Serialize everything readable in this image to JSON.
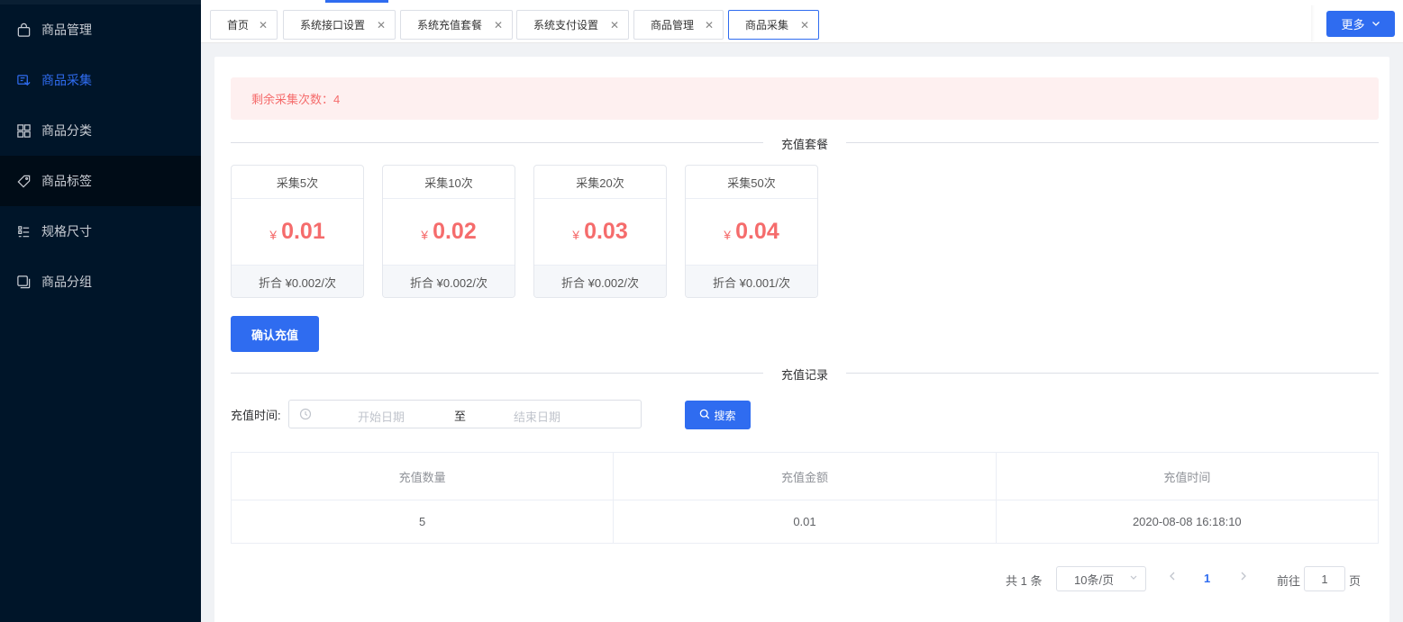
{
  "sidebar": {
    "items": [
      {
        "label": "商品管理",
        "icon": "shopping-bag-icon",
        "active": false
      },
      {
        "label": "商品采集",
        "icon": "collect-icon",
        "active": true
      },
      {
        "label": "商品分类",
        "icon": "grid-icon",
        "active": false
      },
      {
        "label": "商品标签",
        "icon": "tag-icon",
        "active": false
      },
      {
        "label": "规格尺寸",
        "icon": "list-icon",
        "active": false
      },
      {
        "label": "商品分组",
        "icon": "copy-icon",
        "active": false
      }
    ]
  },
  "tabs": [
    {
      "label": "首页",
      "active": false
    },
    {
      "label": "系统接口设置",
      "active": false
    },
    {
      "label": "系统充值套餐",
      "active": false
    },
    {
      "label": "系统支付设置",
      "active": false
    },
    {
      "label": "商品管理",
      "active": false
    },
    {
      "label": "商品采集",
      "active": true
    }
  ],
  "more_button": "更多",
  "alert": "剩余采集次数：4",
  "sections": {
    "packages_title": "充值套餐",
    "records_title": "充值记录"
  },
  "packages": [
    {
      "name": "采集5次",
      "currency": "¥",
      "price": "0.01",
      "unit": "折合 ¥0.002/次"
    },
    {
      "name": "采集10次",
      "currency": "¥",
      "price": "0.02",
      "unit": "折合 ¥0.002/次"
    },
    {
      "name": "采集20次",
      "currency": "¥",
      "price": "0.03",
      "unit": "折合 ¥0.002/次"
    },
    {
      "name": "采集50次",
      "currency": "¥",
      "price": "0.04",
      "unit": "折合 ¥0.001/次"
    }
  ],
  "confirm_button": "确认充值",
  "filter": {
    "label": "充值时间:",
    "start_placeholder": "开始日期",
    "separator": "至",
    "end_placeholder": "结束日期",
    "search_button": "搜索"
  },
  "table": {
    "columns": [
      "充值数量",
      "充值金额",
      "充值时间"
    ],
    "rows": [
      [
        "5",
        "0.01",
        "2020-08-08 16:18:10"
      ]
    ]
  },
  "pagination": {
    "total": "共 1 条",
    "page_size": "10条/页",
    "current_page": "1",
    "goto_label": "前往",
    "goto_value": "1",
    "page_suffix": "页"
  },
  "colors": {
    "primary": "#2f6cf0",
    "sidebar_bg": "#001529",
    "alert_bg": "#fef0f0",
    "danger": "#f56c6c"
  }
}
